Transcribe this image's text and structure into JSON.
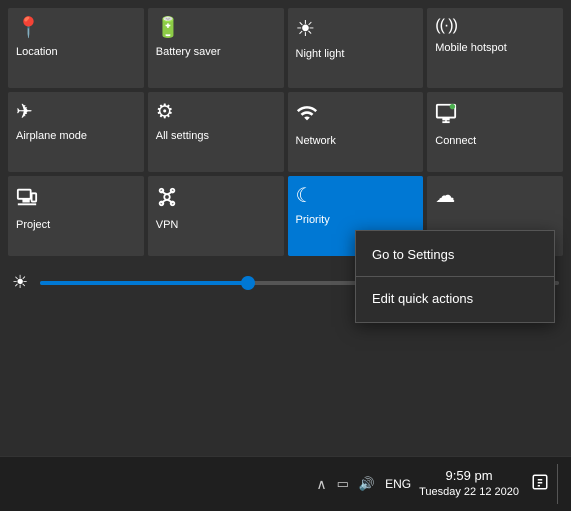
{
  "actionCenter": {
    "tiles": [
      {
        "id": "location",
        "label": "Location",
        "icon": "📍",
        "active": false
      },
      {
        "id": "battery-saver",
        "label": "Battery saver",
        "icon": "🔋",
        "active": false
      },
      {
        "id": "night-light",
        "label": "Night light",
        "icon": "☀",
        "active": false
      },
      {
        "id": "mobile-hotspot",
        "label": "Mobile hotspot",
        "icon": "hotspot",
        "active": false
      },
      {
        "id": "airplane-mode",
        "label": "Airplane mode",
        "icon": "✈",
        "active": false
      },
      {
        "id": "all-settings",
        "label": "All settings",
        "icon": "⚙",
        "active": false
      },
      {
        "id": "network",
        "label": "Network",
        "icon": "network",
        "active": false
      },
      {
        "id": "connect",
        "label": "Connect",
        "icon": "connect",
        "active": false
      },
      {
        "id": "project",
        "label": "Project",
        "icon": "project",
        "active": false
      },
      {
        "id": "vpn",
        "label": "VPN",
        "icon": "vpn",
        "active": false
      },
      {
        "id": "priority",
        "label": "Priority",
        "icon": "☾",
        "active": true
      },
      {
        "id": "focus",
        "label": "",
        "icon": "☁",
        "active": false
      }
    ],
    "brightness": {
      "value": 40
    }
  },
  "contextMenu": {
    "items": [
      {
        "id": "go-to-settings",
        "label": "Go to Settings"
      },
      {
        "id": "edit-quick-actions",
        "label": "Edit quick actions"
      }
    ]
  },
  "taskbar": {
    "chevronUp": "∧",
    "batteryIcon": "▭",
    "volumeIcon": "🔊",
    "language": "ENG",
    "time": "9:59 pm",
    "date": "Tuesday 22 12 2020",
    "actionCenterIcon": "⬜"
  }
}
